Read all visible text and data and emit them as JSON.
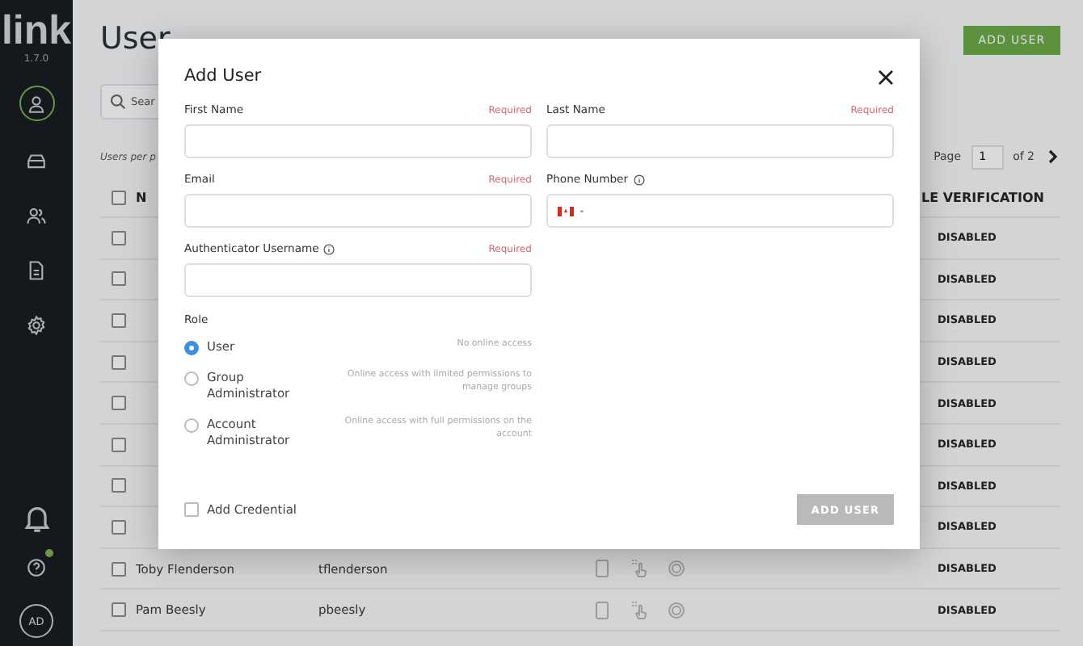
{
  "sidebar": {
    "logo": "link",
    "version": "1.7.0",
    "nav": [
      {
        "kind": "user",
        "selected": true
      },
      {
        "kind": "inbox",
        "selected": false
      },
      {
        "kind": "users",
        "selected": false
      },
      {
        "kind": "document",
        "selected": false
      },
      {
        "kind": "settings",
        "selected": false
      }
    ],
    "help_badge": true,
    "avatar": "AD"
  },
  "page": {
    "title": "User",
    "add_button": "ADD USER",
    "search": {
      "placeholder": "Sear"
    },
    "per_page": "Users per p",
    "pagination": {
      "label": "Page",
      "value": "1",
      "total": "of 2"
    },
    "table": {
      "select_all": {
        "checked": false
      },
      "columns": [
        {
          "label": "N"
        },
        {
          "label": "LE VERIFICATION"
        }
      ],
      "rows": [
        {
          "checked": false,
          "verification": "DISABLED"
        },
        {
          "checked": false,
          "verification": "DISABLED"
        },
        {
          "checked": false,
          "verification": "DISABLED"
        },
        {
          "checked": false,
          "verification": "DISABLED"
        },
        {
          "checked": false,
          "verification": "DISABLED"
        },
        {
          "checked": false,
          "verification": "DISABLED"
        },
        {
          "checked": false,
          "verification": "DISABLED"
        },
        {
          "checked": false,
          "verification": "DISABLED"
        },
        {
          "checked": false,
          "name": "Toby Flenderson",
          "username": "tflenderson",
          "verification": "DISABLED"
        },
        {
          "checked": false,
          "name": "Pam Beesly",
          "username": "pbeesly",
          "verification": "DISABLED"
        }
      ]
    }
  },
  "dialog": {
    "title": "Add User",
    "fields": [
      {
        "label": "First Name",
        "required": "Required",
        "kind": "text",
        "info": false
      },
      {
        "label": "Last Name",
        "required": "Required",
        "kind": "text",
        "info": false
      },
      {
        "label": "Email",
        "required": "Required",
        "kind": "text",
        "info": false
      },
      {
        "label": "Phone Number",
        "kind": "phone",
        "info": true
      },
      {
        "label": "Authenticator Username",
        "required": "Required",
        "kind": "text",
        "info": true
      }
    ],
    "role_label": "Role",
    "roles": [
      {
        "label": "User",
        "description": "No online access",
        "selected": true
      },
      {
        "label": "Group Administrator",
        "description": "Online access with limited permissions to manage groups",
        "selected": false
      },
      {
        "label": "Account Administrator",
        "description": "Online access with full permissions on the account",
        "selected": false
      }
    ],
    "add_credential": {
      "label": "Add Credential",
      "checked": false
    },
    "submit": {
      "label": "ADD USER",
      "disabled": true
    }
  }
}
